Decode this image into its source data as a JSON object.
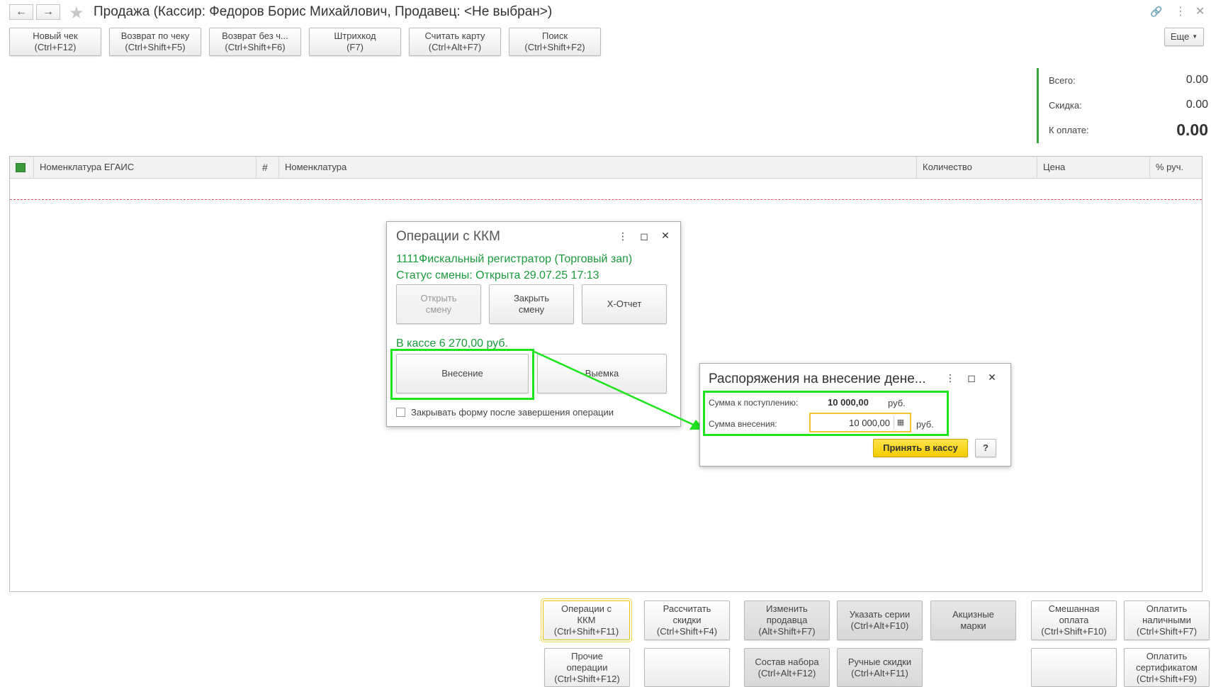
{
  "window": {
    "title": "Продажа (Кассир: Федоров Борис Михайлович, Продавец: <Не выбран>)",
    "more_label": "Еще",
    "more_icon": "chevron-down-icon"
  },
  "toolbar": [
    {
      "line1": "Новый чек",
      "line2": "(Ctrl+F12)"
    },
    {
      "line1": "Возврат по чеку",
      "line2": "(Ctrl+Shift+F5)"
    },
    {
      "line1": "Возврат без ч...",
      "line2": "(Ctrl+Shift+F6)"
    },
    {
      "line1": "Штрихкод",
      "line2": "(F7)"
    },
    {
      "line1": "Считать карту",
      "line2": "(Ctrl+Alt+F7)"
    },
    {
      "line1": "Поиск",
      "line2": "(Ctrl+Shift+F2)"
    }
  ],
  "totals": {
    "total_label": "Всего:",
    "total_value": "0.00",
    "discount_label": "Скидка:",
    "discount_value": "0.00",
    "pay_label": "К оплате:",
    "pay_value": "0.00",
    "accent_color": "#3ba33b"
  },
  "table": {
    "columns": [
      "Номенклатура ЕГАИС",
      "Номенклатура",
      "Количество",
      "Цена",
      "% руч."
    ]
  },
  "kkm_dialog": {
    "title": "Операции с ККМ",
    "device": "1111Фискальный регистратор (Торговый зап)",
    "shift_status": "Статус смены: Открыта 29.07.25 17:13",
    "open_shift_1": "Открыть",
    "open_shift_2": "смену",
    "close_shift_1": "Закрыть",
    "close_shift_2": "смену",
    "x_report": "X-Отчет",
    "cash_balance": "В кассе 6 270,00 руб.",
    "deposit": "Внесение",
    "withdrawal": "Выемка",
    "close_after_label": "Закрывать форму после завершения операции"
  },
  "deposit_dialog": {
    "title": "Распоряжения на внесение дене...",
    "expected_label": "Сумма к поступлению:",
    "expected_value": "10 000,00",
    "currency": "руб.",
    "amount_label": "Сумма внесения:",
    "amount_value": "10 000,00",
    "accept_button": "Принять в кассу",
    "help_button": "?",
    "accept_color": "#f5d000"
  },
  "bottom_buttons": {
    "kkm_ops": [
      "Операции с",
      "ККМ",
      "(Ctrl+Shift+F11)"
    ],
    "calc_discounts": [
      "Рассчитать",
      "скидки",
      "(Ctrl+Shift+F4)"
    ],
    "change_seller": [
      "Изменить",
      "продавца",
      "(Alt+Shift+F7)"
    ],
    "series": [
      "Указать серии",
      "(Ctrl+Alt+F10)"
    ],
    "excise": [
      "Акцизные",
      "марки"
    ],
    "mixed_pay": [
      "Смешанная",
      "оплата",
      "(Ctrl+Shift+F10)"
    ],
    "pay_cash": [
      "Оплатить",
      "наличными",
      "(Ctrl+Shift+F7)"
    ],
    "other_ops": [
      "Прочие",
      "операции",
      "(Ctrl+Shift+F12)"
    ],
    "kit": [
      "Состав набора",
      "(Ctrl+Alt+F12)"
    ],
    "manual_discounts": [
      "Ручные скидки",
      "(Ctrl+Alt+F11)"
    ],
    "pay_cert": [
      "Оплатить",
      "сертификатом",
      "(Ctrl+Shift+F9)"
    ]
  },
  "highlight_color": "#1ee31e"
}
